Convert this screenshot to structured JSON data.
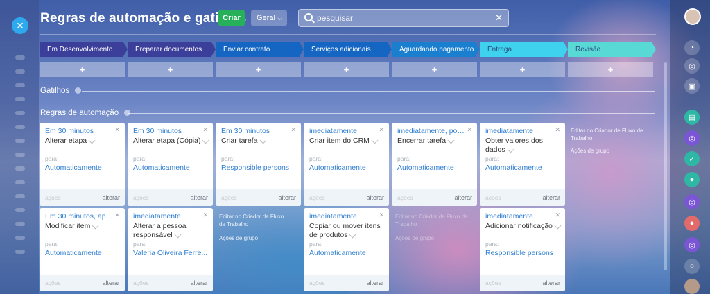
{
  "header": {
    "title": "Regras de automação e gatilhos",
    "create_label": "Criar",
    "general_label": "Geral",
    "search_placeholder": "pesquisar"
  },
  "stages": [
    {
      "label": "Em Desenvolvimento",
      "color": "#3b3f9a"
    },
    {
      "label": "Preparar documentos",
      "color": "#3b3f9a"
    },
    {
      "label": "Enviar contrato",
      "color": "#1466c2"
    },
    {
      "label": "Serviços adicionais",
      "color": "#1466c2"
    },
    {
      "label": "Aguardando pagamento",
      "color": "#1b7fd0"
    },
    {
      "label": "Entrega",
      "color": "#3fd2ef"
    },
    {
      "label": "Revisão",
      "color": "#58d9d6"
    }
  ],
  "plus_label": "+",
  "sections": {
    "triggers": "Gatilhos",
    "rules": "Regras de automação"
  },
  "cards": [
    {
      "when": "Em 30 minutos",
      "name": "Alterar etapa",
      "para": "para:",
      "target": "Automaticamente",
      "acoes": "ações",
      "alterar": "alterar"
    },
    {
      "when": "Em 30 minutos",
      "name": "Alterar etapa (Cópia)",
      "para": "para:",
      "target": "Automaticamente",
      "acoes": "ações",
      "alterar": "alterar"
    },
    {
      "when": "Em 30 minutos",
      "name": "Criar tarefa",
      "para": "para:",
      "target": "Responsible persons",
      "acoes": "ações",
      "alterar": "alterar"
    },
    {
      "when": "imediatamente",
      "name": "Criar item do CRM",
      "para": "para:",
      "target": "Automaticamente",
      "acoes": "ações",
      "alterar": "alterar"
    },
    {
      "when": "imediatamente, por co...",
      "name": "Encerrar tarefa",
      "para": "para:",
      "target": "Automaticamente",
      "acoes": "ações",
      "alterar": "alterar"
    },
    {
      "when": "imediatamente",
      "name": "Obter valores dos dados",
      "para": "para:",
      "target": "Automaticamente",
      "acoes": "ações",
      "alterar": "alterar"
    },
    {
      "when": "Em 30 minutos, após a...",
      "name": "Modificar item",
      "para": "para:",
      "target": "Automaticamente",
      "acoes": "ações",
      "alterar": "alterar"
    },
    {
      "when": "imediatamente",
      "name": "Alterar a pessoa responsável",
      "para": "para:",
      "target": "Valeria Oliveira Ferre...",
      "acoes": "ações",
      "alterar": "alterar"
    },
    {
      "when": "imediatamente",
      "name": "Copiar ou mover itens de produtos",
      "para": "para:",
      "target": "Automaticamente",
      "acoes": "ações",
      "alterar": "alterar"
    },
    {
      "when": "imediatamente",
      "name": "Adicionar notificação",
      "para": "para:",
      "target": "Responsible persons",
      "acoes": "ações",
      "alterar": "alterar"
    }
  ],
  "column_links": [
    {
      "edit": "Editar no Criador de Fluxo de Trabalho",
      "group": "Ações de grupo"
    },
    {
      "edit": "Editar no Criador de Fluxo de Trabalho",
      "group": "Ações de grupo"
    },
    {
      "edit": "Editar no Criador de Fluxo de Trabalho",
      "group": "Ações de grupo"
    }
  ]
}
